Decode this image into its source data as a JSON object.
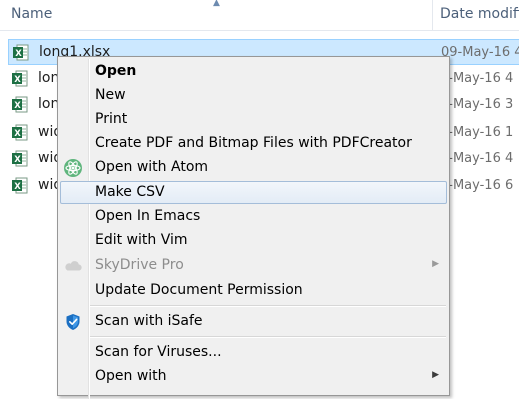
{
  "header": {
    "name_label": "Name",
    "date_label": "Date modifi"
  },
  "files": [
    {
      "name": "long1.xlsx",
      "date": "09-May-16 4"
    },
    {
      "name": "lon",
      "date": "9-May-16 4"
    },
    {
      "name": "lon",
      "date": "0-May-16 3"
    },
    {
      "name": "wid",
      "date": "6-May-16 1"
    },
    {
      "name": "wid",
      "date": "9-May-16 4"
    },
    {
      "name": "wid",
      "date": "0-May-16 6"
    }
  ],
  "context_menu": {
    "open": "Open",
    "new": "New",
    "print": "Print",
    "create_pdf": "Create PDF and Bitmap Files with PDFCreator",
    "open_with_atom": "Open with Atom",
    "make_csv": "Make CSV",
    "open_in_emacs": "Open In Emacs",
    "edit_with_vim": "Edit with Vim",
    "skydrive_pro": "SkyDrive Pro",
    "update_permission": "Update Document Permission",
    "scan_isafe": "Scan with iSafe",
    "scan_viruses": "Scan for Viruses...",
    "open_with": "Open with"
  },
  "icons": {
    "file": "excel-file-icon",
    "atom": "atom-icon",
    "skydrive": "cloud-icon",
    "isafe": "shield-icon"
  },
  "colors": {
    "selection_bg": "#cce8ff",
    "menu_bg": "#f0f0f0",
    "highlight_bg": "#e8eff7",
    "excel_green": "#1d7044"
  }
}
